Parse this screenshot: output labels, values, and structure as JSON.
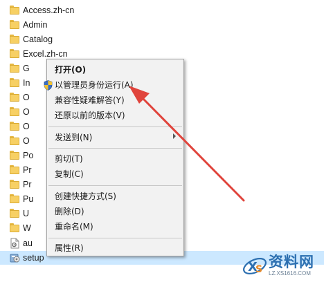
{
  "files": [
    {
      "name": "Access.zh-cn",
      "icon": "folder-icon"
    },
    {
      "name": "Admin",
      "icon": "folder-icon"
    },
    {
      "name": "Catalog",
      "icon": "folder-icon"
    },
    {
      "name": "Excel.zh-cn",
      "icon": "folder-icon"
    },
    {
      "name": "G",
      "icon": "folder-icon"
    },
    {
      "name": "In",
      "icon": "folder-icon"
    },
    {
      "name": "O",
      "icon": "folder-icon"
    },
    {
      "name": "O",
      "icon": "folder-icon"
    },
    {
      "name": "O",
      "icon": "folder-icon"
    },
    {
      "name": "O",
      "icon": "folder-icon"
    },
    {
      "name": "Po",
      "icon": "folder-icon"
    },
    {
      "name": "Pr",
      "icon": "folder-icon"
    },
    {
      "name": "Pr",
      "icon": "folder-icon"
    },
    {
      "name": "Pu",
      "icon": "folder-icon"
    },
    {
      "name": "U",
      "icon": "folder-icon"
    },
    {
      "name": "W",
      "icon": "folder-icon"
    },
    {
      "name": "au",
      "icon": "file-icon"
    },
    {
      "name": "setup",
      "icon": "setup-icon"
    }
  ],
  "context_menu": {
    "items": [
      {
        "label": "打开(O)",
        "bold": true
      },
      {
        "label": "以管理员身份运行(A)",
        "icon": "shield-icon"
      },
      {
        "label": "兼容性疑难解答(Y)"
      },
      {
        "label": "还原以前的版本(V)"
      },
      {
        "label": "发送到(N)",
        "submenu": true
      },
      {
        "label": "剪切(T)"
      },
      {
        "label": "复制(C)"
      },
      {
        "label": "创建快捷方式(S)"
      },
      {
        "label": "删除(D)"
      },
      {
        "label": "重命名(M)"
      },
      {
        "label": "属性(R)"
      }
    ]
  },
  "watermark": {
    "title": "资料网",
    "url": "LZ.XS1616.COM"
  },
  "colors": {
    "annotation_arrow": "#e0443c",
    "selection": "#cce8ff",
    "menu_background": "#f2f2f2"
  }
}
